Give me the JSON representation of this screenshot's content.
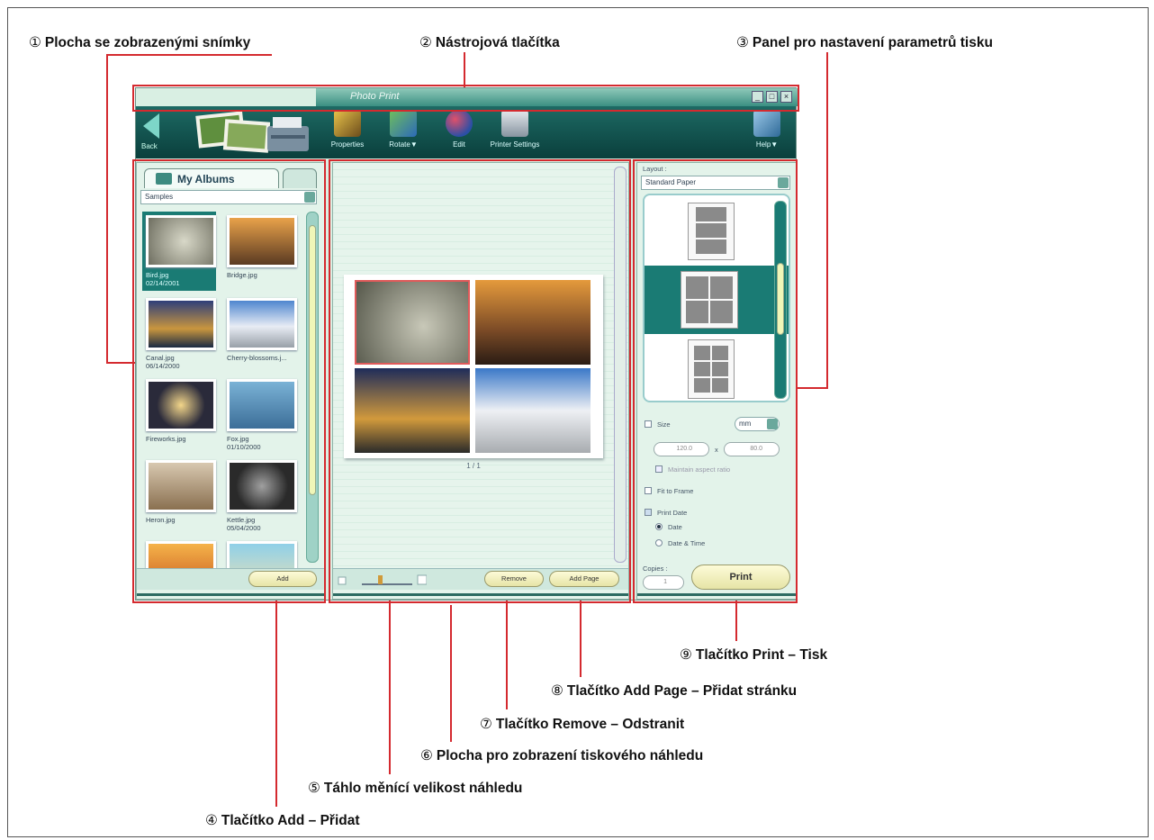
{
  "callouts": {
    "c1": {
      "num": "①",
      "text": "Plocha se zobrazenými snímky"
    },
    "c2": {
      "num": "②",
      "text": "Nástrojová tlačítka"
    },
    "c3": {
      "num": "③",
      "text": "Panel pro nastavení parametrů tisku"
    },
    "c4": {
      "num": "④",
      "text": "Tlačítko Add – Přidat"
    },
    "c5": {
      "num": "⑤",
      "text": "Táhlo měnící velikost náhledu"
    },
    "c6": {
      "num": "⑥",
      "text": "Plocha pro zobrazení tiskového náhledu"
    },
    "c7": {
      "num": "⑦",
      "text": "Tlačítko Remove – Odstranit"
    },
    "c8": {
      "num": "⑧",
      "text": "Tlačítko Add Page – Přidat stránku"
    },
    "c9": {
      "num": "⑨",
      "text": "Tlačítko Print – Tisk"
    }
  },
  "window": {
    "title": "Photo Print",
    "minimize": "_",
    "restore": "□",
    "close": "×"
  },
  "toolbar": {
    "back_label": "Back",
    "tools": [
      "Properties",
      "Rotate▼",
      "Edit",
      "Printer Settings",
      "Help▼"
    ]
  },
  "left": {
    "tab_label": "My Albums",
    "album_select": "Samples",
    "thumbnails": [
      {
        "caption": "Bird.jpg\n02/14/2001"
      },
      {
        "caption": "Bridge.jpg"
      },
      {
        "caption": "Canal.jpg\n06/14/2000"
      },
      {
        "caption": "Cherry-blossoms.j..."
      },
      {
        "caption": "Fireworks.jpg"
      },
      {
        "caption": "Fox.jpg\n01/10/2000"
      },
      {
        "caption": "Heron.jpg"
      },
      {
        "caption": "Kettle.jpg\n05/04/2000"
      },
      {
        "caption": ""
      },
      {
        "caption": ""
      }
    ],
    "add_label": "Add"
  },
  "middle": {
    "page_indicator": "1 / 1",
    "remove_label": "Remove",
    "add_page_label": "Add Page"
  },
  "right": {
    "layout_label": "Layout :",
    "paper_select": "Standard Paper",
    "size_label": "Size",
    "unit_select": "mm",
    "width_value": "120.0",
    "height_value": "80.0",
    "times": "x",
    "keep_aspect_label": "Maintain aspect ratio",
    "fit_label": "Fit to Frame",
    "print_date_label": "Print Date",
    "date_label": "Date",
    "date_time_label": "Date & Time",
    "copies_label": "Copies :",
    "copies_value": "1",
    "print_label": "Print"
  }
}
